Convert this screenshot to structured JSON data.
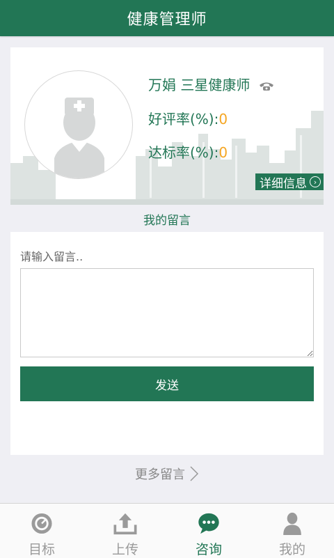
{
  "header": {
    "title": "健康管理师"
  },
  "profile": {
    "name": "万娟  三星健康师",
    "good_rate_label": "好评率(%):",
    "good_rate_value": "0",
    "reach_rate_label": "达标率(%):",
    "reach_rate_value": "0",
    "detail_label": "详细信息"
  },
  "messages": {
    "section_title": "我的留言",
    "input_label": "请输入留言..",
    "textarea_value": "",
    "send_label": "发送",
    "more_label": "更多留言"
  },
  "tabbar": {
    "items": [
      {
        "label": "目标",
        "icon": "target-icon"
      },
      {
        "label": "上传",
        "icon": "upload-icon"
      },
      {
        "label": "咨询",
        "icon": "chat-icon",
        "active": true
      },
      {
        "label": "我的",
        "icon": "person-icon"
      }
    ]
  },
  "colors": {
    "primary": "#227655",
    "accent_value": "#f5a623",
    "background": "#efeff4"
  }
}
